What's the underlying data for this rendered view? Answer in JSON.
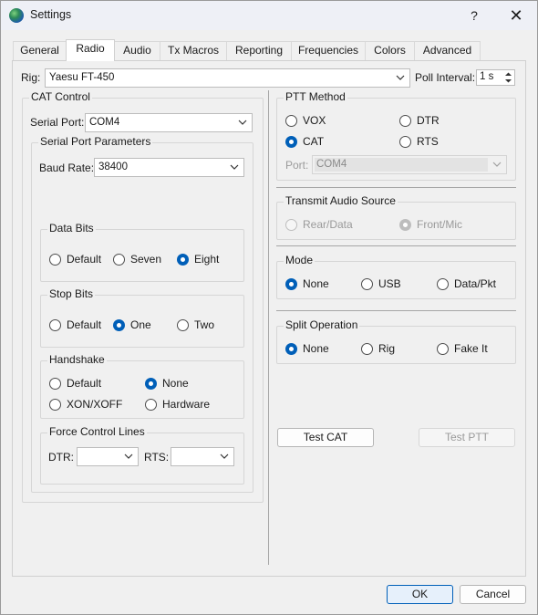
{
  "window": {
    "title": "Settings",
    "help_label": "?",
    "close_label": "✕"
  },
  "tabs": [
    {
      "label": "General",
      "active": false
    },
    {
      "label": "Radio",
      "active": true
    },
    {
      "label": "Audio",
      "active": false
    },
    {
      "label": "Tx Macros",
      "active": false
    },
    {
      "label": "Reporting",
      "active": false
    },
    {
      "label": "Frequencies",
      "active": false
    },
    {
      "label": "Colors",
      "active": false
    },
    {
      "label": "Advanced",
      "active": false
    }
  ],
  "rig": {
    "label": "Rig:",
    "value": "Yaesu FT-450",
    "poll_label": "Poll Interval:",
    "poll_value": "1 s"
  },
  "cat_control": {
    "title": "CAT Control",
    "serial_port_label": "Serial Port:",
    "serial_port_value": "COM4",
    "spp": {
      "title": "Serial Port Parameters",
      "baud_label": "Baud Rate:",
      "baud_value": "38400"
    },
    "data_bits": {
      "title": "Data Bits",
      "options": [
        "Default",
        "Seven",
        "Eight"
      ],
      "selected": "Eight"
    },
    "stop_bits": {
      "title": "Stop Bits",
      "options": [
        "Default",
        "One",
        "Two"
      ],
      "selected": "One"
    },
    "handshake": {
      "title": "Handshake",
      "options": [
        "Default",
        "None",
        "XON/XOFF",
        "Hardware"
      ],
      "selected": "None"
    },
    "force": {
      "title": "Force Control Lines",
      "dtr_label": "DTR:",
      "dtr_value": "",
      "rts_label": "RTS:",
      "rts_value": ""
    }
  },
  "ptt": {
    "title": "PTT Method",
    "options": [
      "VOX",
      "DTR",
      "CAT",
      "RTS"
    ],
    "selected": "CAT",
    "port_label": "Port:",
    "port_value": "COM4"
  },
  "tx_audio": {
    "title": "Transmit Audio Source",
    "options": [
      "Rear/Data",
      "Front/Mic"
    ],
    "selected": "Front/Mic"
  },
  "mode": {
    "title": "Mode",
    "options": [
      "None",
      "USB",
      "Data/Pkt"
    ],
    "selected": "None"
  },
  "split": {
    "title": "Split Operation",
    "options": [
      "None",
      "Rig",
      "Fake It"
    ],
    "selected": "None"
  },
  "buttons": {
    "test_cat": "Test CAT",
    "test_ptt": "Test PTT",
    "ok": "OK",
    "cancel": "Cancel"
  },
  "colors": {
    "accent": "#005fb8"
  },
  "icons": {
    "app": "globe-icon",
    "chevron": "chevron-down-icon"
  }
}
